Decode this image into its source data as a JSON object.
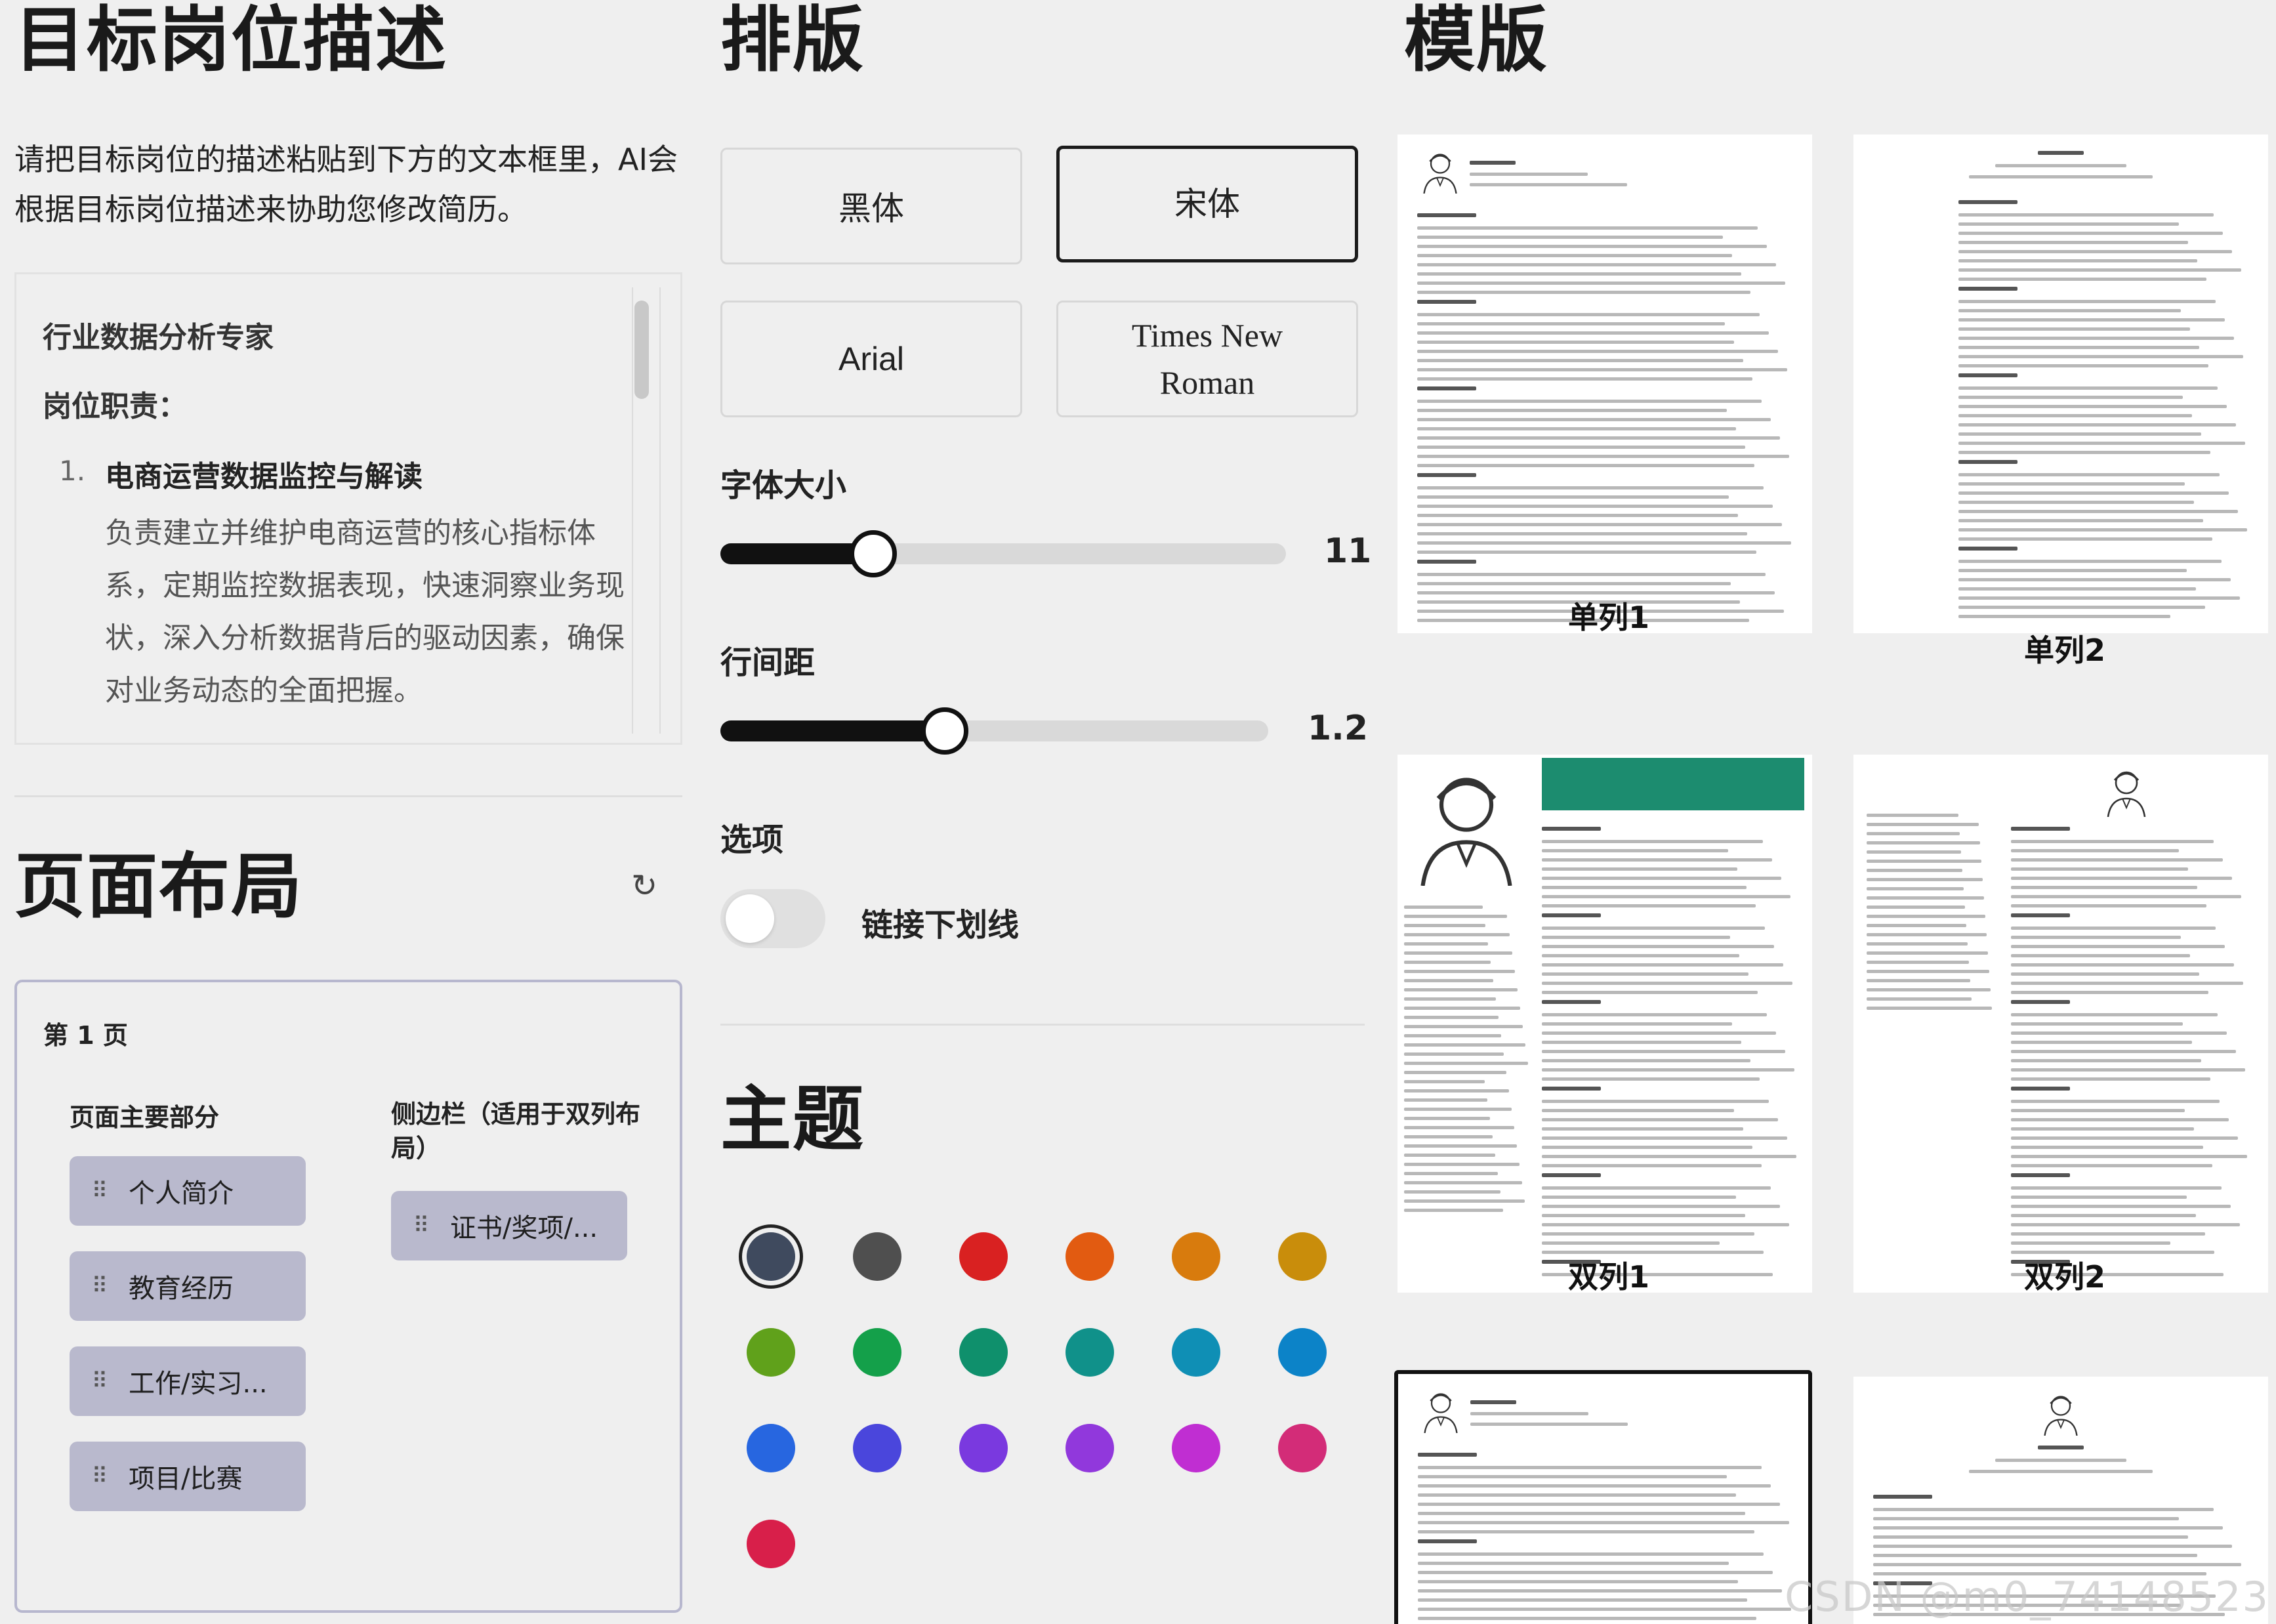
{
  "job": {
    "heading": "目标岗位描述",
    "instructions": "请把目标岗位的描述粘贴到下方的文本框里，AI会根据目标岗位描述来协助您修改简历。",
    "content": {
      "title": "行业数据分析专家",
      "section": "岗位职责：",
      "item_number": "1.",
      "item_title": "电商运营数据监控与解读",
      "item_body": "负责建立并维护电商运营的核心指标体系，定期监控数据表现，快速洞察业务现状，深入分析数据背后的驱动因素，确保对业务动态的全面把握。"
    }
  },
  "layout": {
    "heading": "页面布局",
    "reset_icon": "reset-icon",
    "page_label": "第 1 页",
    "main_label": "页面主要部分",
    "sidebar_label": "侧边栏（适用于双列布局）",
    "main_items": [
      "个人简介",
      "教育经历",
      "工作/实习...",
      "项目/比赛"
    ],
    "sidebar_items": [
      "证书/奖项/..."
    ],
    "grip_icon": "drag-handle-icon"
  },
  "typography": {
    "heading": "排版",
    "fonts": [
      {
        "label": "黑体",
        "active": false
      },
      {
        "label": "宋体",
        "active": true
      },
      {
        "label": "Arial",
        "active": false
      },
      {
        "label": "Times New Roman",
        "active": false
      }
    ],
    "font_size": {
      "label": "字体大小",
      "value": "11",
      "fraction": 0.27
    },
    "line_height": {
      "label": "行间距",
      "value": "1.2",
      "fraction": 0.41
    },
    "options_label": "选项",
    "link_underline": {
      "label": "链接下划线",
      "enabled": false
    }
  },
  "theme": {
    "heading": "主题",
    "selected": "#3f4a5e",
    "colors": [
      "#3f4a5e",
      "#4f4f4f",
      "#d92121",
      "#e25b11",
      "#d87b0d",
      "#c98d0b",
      "#60a11b",
      "#14a04a",
      "#0f906c",
      "#10918a",
      "#0f8fb5",
      "#0c83c8",
      "#2766e0",
      "#4a46dc",
      "#7a39df",
      "#9138dc",
      "#c02ed2",
      "#d32c78",
      "#d81f4a"
    ]
  },
  "templates": {
    "heading": "模版",
    "items": [
      {
        "label": "单列1",
        "active": false
      },
      {
        "label": "单列2",
        "active": false
      },
      {
        "label": "双列1",
        "active": false
      },
      {
        "label": "双列2",
        "active": false
      },
      {
        "label": "",
        "active": true
      },
      {
        "label": "",
        "active": false
      }
    ]
  },
  "watermark": "CSDN @m0_74148523"
}
